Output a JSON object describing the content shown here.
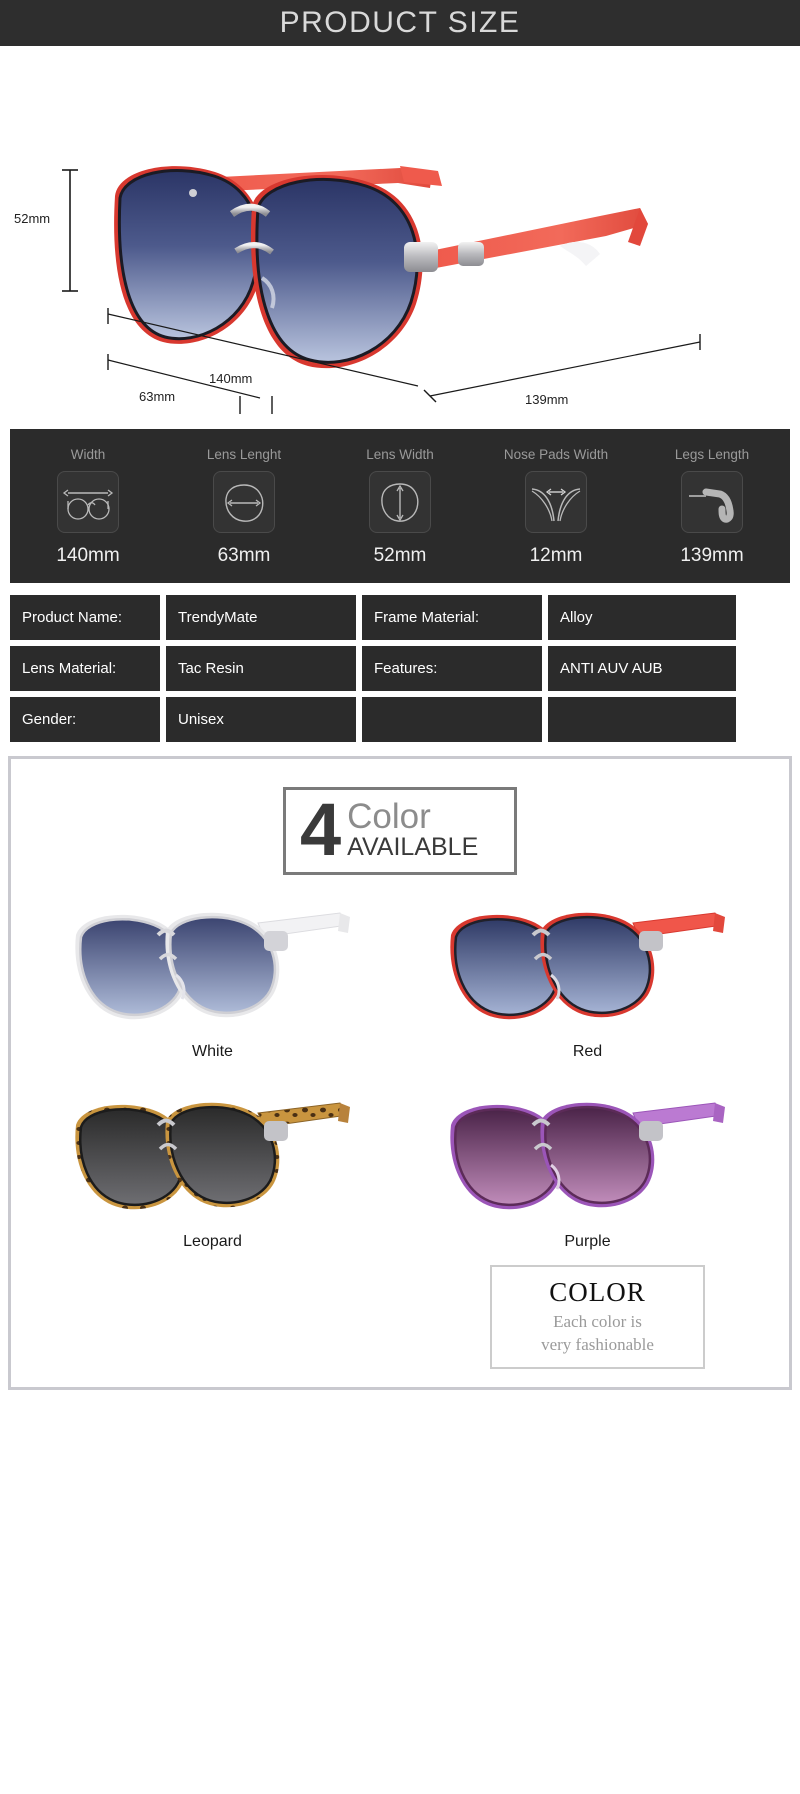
{
  "banner": {
    "title": "PRODUCT SIZE"
  },
  "hero": {
    "dimensions": {
      "height": "52mm",
      "width": "140mm",
      "lens_length": "63mm",
      "nose_pads": "12mm",
      "legs": "139mm"
    }
  },
  "icon_strip": [
    {
      "caption": "Width",
      "value": "140mm",
      "icon": "glasses-width-icon"
    },
    {
      "caption": "Lens Lenght",
      "value": "63mm",
      "icon": "lens-length-icon"
    },
    {
      "caption": "Lens Width",
      "value": "52mm",
      "icon": "lens-width-icon"
    },
    {
      "caption": "Nose Pads Width",
      "value": "12mm",
      "icon": "nose-pads-width-icon"
    },
    {
      "caption": "Legs Length",
      "value": "139mm",
      "icon": "legs-length-icon"
    }
  ],
  "spec_table": {
    "rows": [
      {
        "label1": "Product Name:",
        "value1": "TrendyMate",
        "label2": "Frame Material:",
        "value2": "Alloy"
      },
      {
        "label1": "Lens Material:",
        "value1": "Tac Resin",
        "label2": "Features:",
        "value2": "ANTI AUV AUB"
      },
      {
        "label1": "Gender:",
        "value1": "Unisex",
        "label2": "",
        "value2": ""
      }
    ]
  },
  "color_section": {
    "count": "4",
    "word_color": "Color",
    "word_available": "AVAILABLE",
    "colors": [
      {
        "name": "White",
        "frame": "#e8e8ea",
        "temple": "#f2f2f4",
        "lens_top": "#3b4470",
        "lens_bottom": "#aebbd8"
      },
      {
        "name": "Red",
        "frame": "#d8382f",
        "temple": "#f0564a",
        "lens_top": "#2f3a66",
        "lens_bottom": "#a5b3d4"
      },
      {
        "name": "Leopard",
        "frame": "#b8823c",
        "temple": "#c9953f",
        "lens_top": "#2a2a2a",
        "lens_bottom": "#6e6e72"
      },
      {
        "name": "Purple",
        "frame": "#9b55b8",
        "temple": "#bb7ad2",
        "lens_top": "#4a2348",
        "lens_bottom": "#a86ea2"
      }
    ],
    "tagline": {
      "title": "COLOR",
      "line1": "Each color is",
      "line2": "very fashionable"
    }
  }
}
